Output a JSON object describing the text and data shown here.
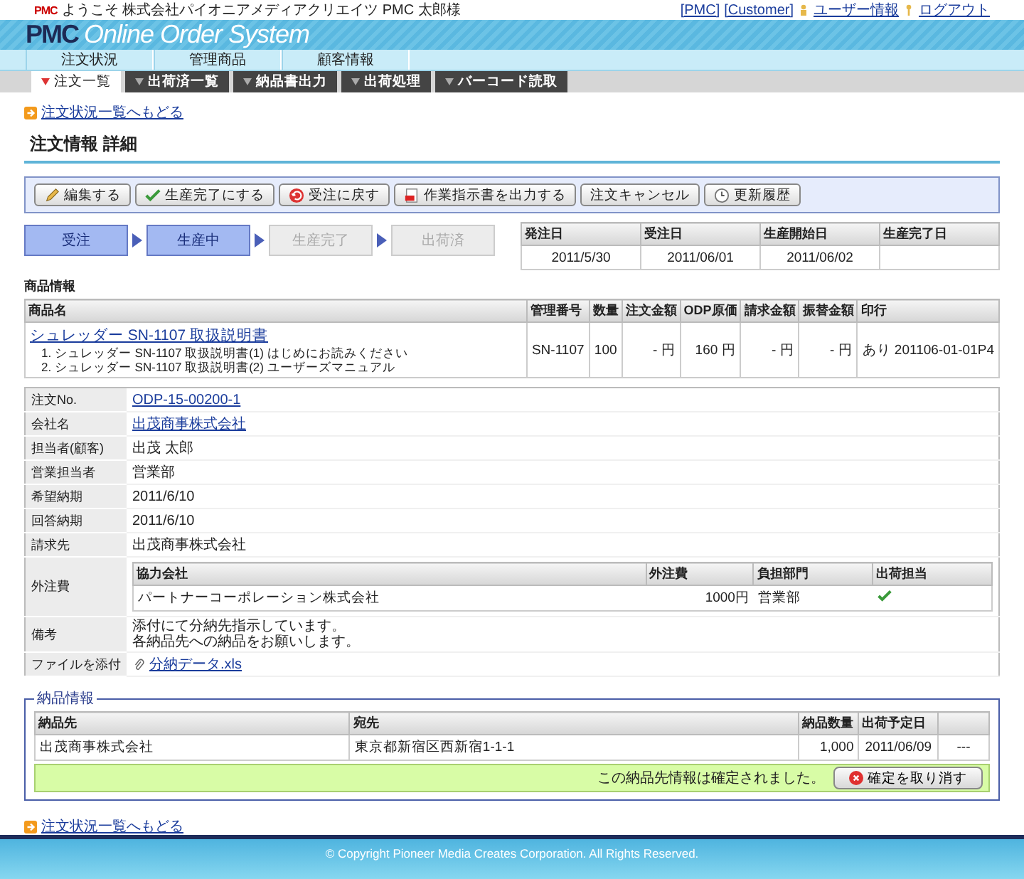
{
  "top_bar": {
    "logo": "PMC",
    "welcome": "ようこそ 株式会社パイオニアメディアクリエイツ PMC 太郎様",
    "links": [
      {
        "label": "[PMC]"
      },
      {
        "label": "[Customer]"
      },
      {
        "label": "ユーザー情報"
      },
      {
        "label": "ログアウト"
      }
    ]
  },
  "banner": {
    "logo": "PMC",
    "title": "Online Order System"
  },
  "nav": [
    {
      "label": "注文状況"
    },
    {
      "label": "管理商品"
    },
    {
      "label": "顧客情報"
    }
  ],
  "subtabs": [
    {
      "label": "注文一覧",
      "selected": true
    },
    {
      "label": "出荷済一覧",
      "selected": false
    },
    {
      "label": "納品書出力",
      "selected": false
    },
    {
      "label": "出荷処理",
      "selected": false
    },
    {
      "label": "バーコード読取",
      "selected": false
    }
  ],
  "back_link_top": "注文状況一覧へもどる",
  "page_title": "注文情報 詳細",
  "actions": [
    {
      "label": "編集する"
    },
    {
      "label": "生産完了にする"
    },
    {
      "label": "受注に戻す"
    },
    {
      "label": "作業指示書を出力する"
    },
    {
      "label": "注文キャンセル"
    },
    {
      "label": "更新履歴"
    }
  ],
  "steps": [
    {
      "label": "受注",
      "active": true
    },
    {
      "label": "生産中",
      "active": true
    },
    {
      "label": "生産完了",
      "active": false
    },
    {
      "label": "出荷済",
      "active": false
    }
  ],
  "dates": {
    "columns": [
      "発注日",
      "受注日",
      "生産開始日",
      "生産完了日"
    ],
    "values": [
      "2011/5/30",
      "2011/06/01",
      "2011/06/02"
    ]
  },
  "product_section": "商品情報",
  "products": {
    "columns": [
      "商品名",
      "管理番号",
      "数量",
      "注文金額",
      "ODP原価",
      "請求金額",
      "振替金額",
      "印行"
    ],
    "rows": [
      {
        "name": "シュレッダー SN-1107 取扱説明書",
        "sub_items": [
          "1. シュレッダー SN-1107 取扱説明書(1) はじめにお読みください",
          "2. シュレッダー SN-1107 取扱説明書(2) ユーザーズマニュアル"
        ],
        "code": "SN-1107",
        "qty": "100",
        "order_amount": "- 円",
        "odp_price": "160 円",
        "billing": "- 円",
        "transfer": "- 円",
        "print": "あり 201106-01-01P4"
      }
    ]
  },
  "details": [
    {
      "kind": "link",
      "label": "注文No.",
      "value": "ODP-15-00200-1"
    },
    {
      "kind": "link",
      "label": "会社名",
      "value": "出茂商事株式会社"
    },
    {
      "kind": "text",
      "label": "担当者(顧客)",
      "value": "出茂 太郎"
    },
    {
      "kind": "text",
      "label": "営業担当者",
      "value": "営業部"
    },
    {
      "kind": "text",
      "label": "希望納期",
      "value": "2011/6/10"
    },
    {
      "kind": "text",
      "label": "回答納期",
      "value": "2011/6/10"
    },
    {
      "kind": "text",
      "label": "請求先",
      "value": "出茂商事株式会社"
    },
    {
      "kind": "subtable",
      "label": "外注費",
      "columns": [
        "協力会社",
        "外注費",
        "負担部門",
        "出荷担当"
      ],
      "rows": [
        {
          "company": "パートナーコーポレーション株式会社",
          "fee": "1000円",
          "dept": "営業部",
          "checked": true
        }
      ]
    },
    {
      "kind": "lines",
      "label": "備考",
      "lines": [
        "添付にて分納先指示しています。",
        "各納品先への納品をお願いします。"
      ]
    },
    {
      "kind": "file",
      "label": "ファイルを添付",
      "value": "分納データ.xls"
    }
  ],
  "delivery": {
    "legend": "納品情報",
    "columns": [
      "納品先",
      "宛先",
      "納品数量",
      "出荷予定日"
    ],
    "rows": [
      {
        "dest": "出茂商事株式会社",
        "address": "東京都新宿区西新宿1-1-1",
        "qty": "1,000",
        "date": "2011/06/09",
        "action": "---"
      }
    ],
    "message": "この納品先情報は確定されました。",
    "cancel_button": "確定を取り消す"
  },
  "back_link_bottom": "注文状況一覧へもどる",
  "footer": "© Copyright Pioneer Media Creates Corporation. All Rights Reserved."
}
